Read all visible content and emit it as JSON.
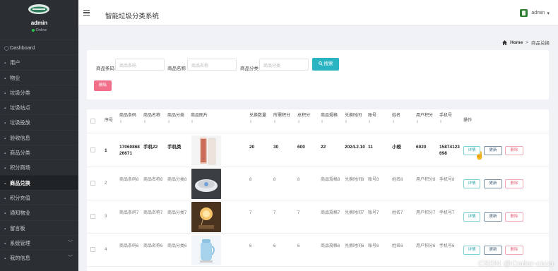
{
  "sidebar": {
    "user_name": "admin",
    "status": "Online",
    "items": [
      {
        "label": "Dashboard",
        "icon": "dashboard-icon",
        "glyph": "◯"
      },
      {
        "label": "用户",
        "icon": "grid-icon",
        "glyph": "▪"
      },
      {
        "label": "物业",
        "icon": "grid-icon",
        "glyph": "▪"
      },
      {
        "label": "垃圾分类",
        "icon": "grid-icon",
        "glyph": "▪"
      },
      {
        "label": "垃圾站点",
        "icon": "grid-icon",
        "glyph": "▪"
      },
      {
        "label": "垃圾投放",
        "icon": "grid-icon",
        "glyph": "▪"
      },
      {
        "label": "验收信息",
        "icon": "grid-icon",
        "glyph": "▪"
      },
      {
        "label": "商品分类",
        "icon": "grid-icon",
        "glyph": "▪"
      },
      {
        "label": "积分商场",
        "icon": "grid-icon",
        "glyph": "▪"
      },
      {
        "label": "商品兑换",
        "icon": "grid-icon",
        "glyph": "▪",
        "active": true
      },
      {
        "label": "积分充值",
        "icon": "grid-icon",
        "glyph": "▪"
      },
      {
        "label": "通知物业",
        "icon": "grid-icon",
        "glyph": "▪"
      },
      {
        "label": "留言板",
        "icon": "grid-icon",
        "glyph": "▪"
      },
      {
        "label": "系统管理",
        "icon": "grid-icon",
        "glyph": "▪",
        "chevron": "﹀"
      },
      {
        "label": "我的信息",
        "icon": "grid-icon",
        "glyph": "▪",
        "chevron": "﹀"
      }
    ]
  },
  "header": {
    "title": "智能垃圾分类系统",
    "user": "admin",
    "user_caret": "▾"
  },
  "breadcrumb": {
    "home_icon": "home-icon",
    "home": "Home",
    "separator": ">",
    "current": "商品兑换"
  },
  "search": {
    "fields": [
      {
        "label": "商品条码",
        "placeholder": "商品条码"
      },
      {
        "label": "商品名称",
        "placeholder": "商品名称"
      },
      {
        "label": "商品分类",
        "placeholder": "商品分类"
      }
    ],
    "search_button": "搜索",
    "delete_button": "删除"
  },
  "table": {
    "sort_glyph": "⇕",
    "columns": [
      {
        "label": "序号",
        "sort": false
      },
      {
        "label": "商品条码",
        "sort": true
      },
      {
        "label": "商品名称",
        "sort": true
      },
      {
        "label": "商品分类",
        "sort": true
      },
      {
        "label": "商品图片",
        "sort": true
      },
      {
        "label": "兑换数量",
        "sort": true
      },
      {
        "label": "所需积分",
        "sort": true
      },
      {
        "label": "总积分",
        "sort": true
      },
      {
        "label": "商品规格",
        "sort": true
      },
      {
        "label": "兑换时间",
        "sort": true
      },
      {
        "label": "账号",
        "sort": true
      },
      {
        "label": "姓名",
        "sort": true
      },
      {
        "label": "用户积分",
        "sort": true
      },
      {
        "label": "手机号",
        "sort": true
      },
      {
        "label": "操作",
        "sort": false
      }
    ],
    "rows": [
      {
        "index": "1",
        "code": "1706086826671",
        "name": "手机22",
        "category": "手机类",
        "image": "phone",
        "qty": "20",
        "points": "30",
        "total": "600",
        "spec": "22",
        "time": "2024.2.10",
        "account": "11",
        "username": "小蛟",
        "user_points": "6020",
        "phone": "15874123698"
      },
      {
        "index": "2",
        "code": "商品条码8",
        "name": "商品名称8",
        "category": "商品分类8",
        "image": "plate",
        "qty": "8",
        "points": "8",
        "total": "8",
        "spec": "商品规格8",
        "time": "兑换时间8",
        "account": "账号8",
        "username": "姓名8",
        "user_points": "用户积分8",
        "phone": "手机号8"
      },
      {
        "index": "3",
        "code": "商品条码7",
        "name": "商品名称7",
        "category": "商品分类7",
        "image": "lamp",
        "qty": "7",
        "points": "7",
        "total": "7",
        "spec": "商品规格7",
        "time": "兑换时间7",
        "account": "账号7",
        "username": "姓名7",
        "user_points": "用户积分7",
        "phone": "手机号7"
      },
      {
        "index": "4",
        "code": "商品条码6",
        "name": "商品名称6",
        "category": "商品分类6",
        "image": "kettle",
        "qty": "6",
        "points": "6",
        "total": "6",
        "spec": "商品规格6",
        "time": "兑换时间6",
        "account": "账号6",
        "username": "姓名6",
        "user_points": "用户积分6",
        "phone": "手机号6"
      }
    ],
    "actions": {
      "detail": "详情",
      "update": "更新",
      "delete": "删除"
    }
  },
  "watermark": "CSDN @Coder-coco",
  "colors": {
    "sidebar": "#2b2f33",
    "accent": "#2ab3c0",
    "danger": "#f26f8a",
    "active_bg": "#1f2326"
  }
}
